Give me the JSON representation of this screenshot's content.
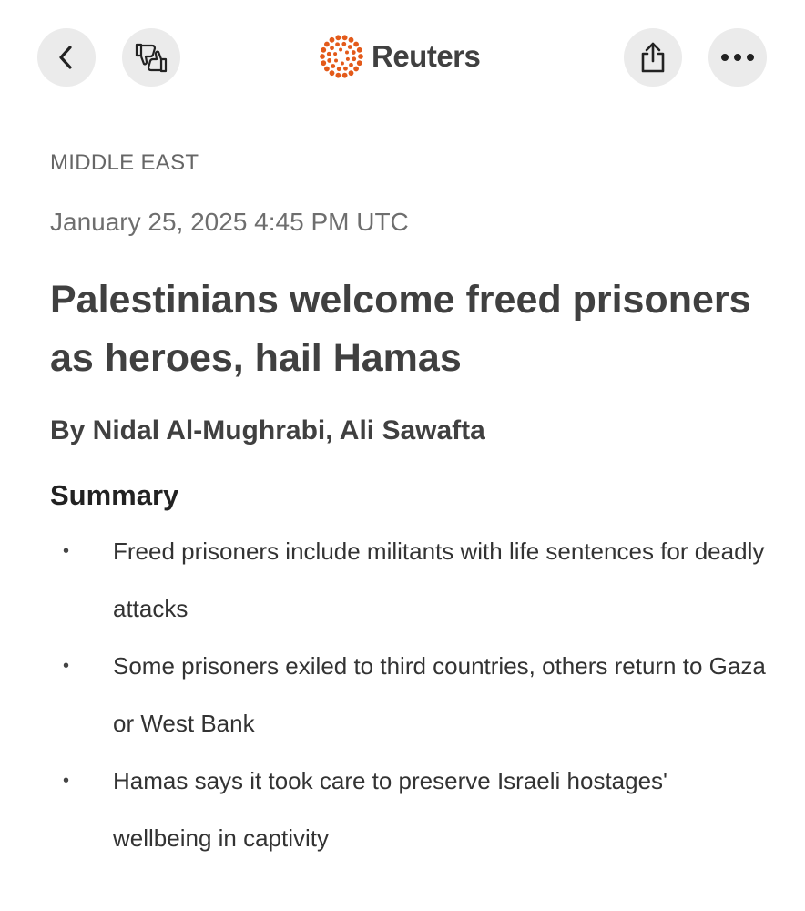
{
  "toolbar": {
    "back_icon": "chevron-left-icon",
    "feedback_icon": "thumbs-up-down-icon",
    "share_icon": "share-icon",
    "more_icon": "ellipsis-icon",
    "brand_name": "Reuters",
    "brand_color": "#e35a1a"
  },
  "article": {
    "section": "MIDDLE EAST",
    "dateline": "January 25, 2025 4:45 PM UTC",
    "headline": "Palestinians welcome freed prisoners as heroes, hail Hamas",
    "byline": "By Nidal Al-Mughrabi, Ali Sawafta",
    "summary_heading": "Summary",
    "summary": [
      "Freed prisoners include militants with life sentences for deadly attacks",
      "Some prisoners exiled to third countries, others return to Gaza or West Bank",
      "Hamas says it took care to preserve Israeli hostages' wellbeing in captivity"
    ]
  }
}
